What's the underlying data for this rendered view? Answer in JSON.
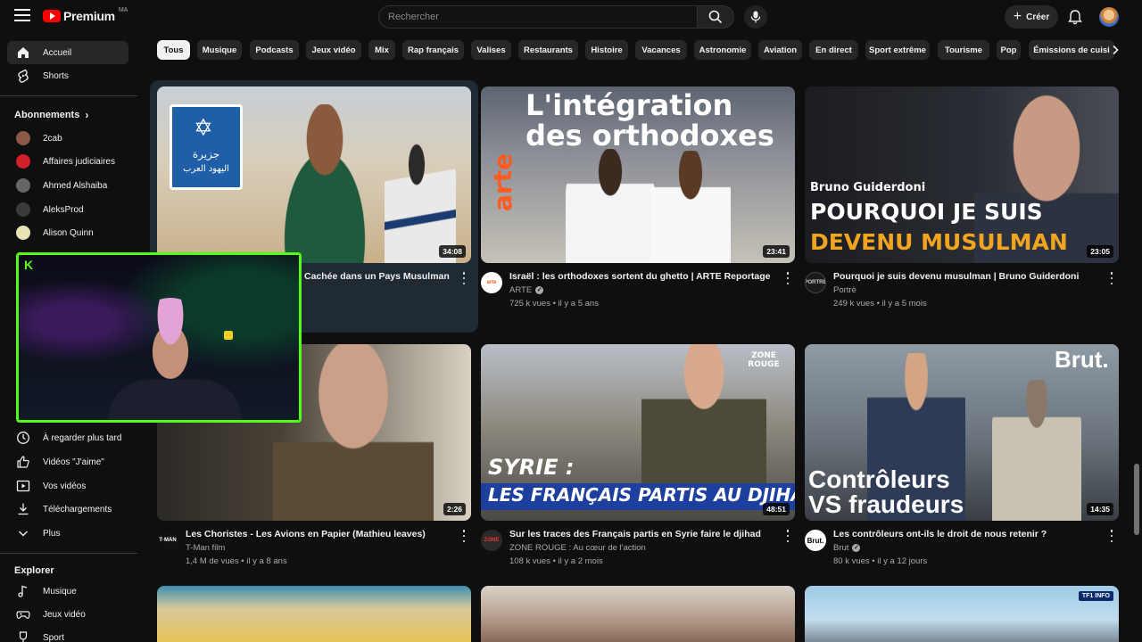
{
  "header": {
    "logo_text": "Premium",
    "logo_region": "MA",
    "search_placeholder": "Rechercher",
    "create_label": "Créer"
  },
  "sidebar": {
    "home": "Accueil",
    "shorts": "Shorts",
    "subscriptions_heading": "Abonnements",
    "subscriptions": [
      {
        "name": "2cab",
        "color": "#8a5a44"
      },
      {
        "name": "Affaires judiciaires",
        "color": "#d0202a"
      },
      {
        "name": "Ahmed Alshaiba",
        "color": "#666666"
      },
      {
        "name": "AleksProd",
        "color": "#3a3a3a"
      },
      {
        "name": "Alison Quinn",
        "color": "#e8e3b5"
      }
    ],
    "you_items": [
      {
        "label": "À regarder plus tard",
        "icon": "clock-icon"
      },
      {
        "label": "Vidéos \"J'aime\"",
        "icon": "thumbs-up-icon"
      },
      {
        "label": "Vos vidéos",
        "icon": "play-square-icon"
      },
      {
        "label": "Téléchargements",
        "icon": "download-icon"
      },
      {
        "label": "Plus",
        "icon": "chevron-down-icon"
      }
    ],
    "explore_heading": "Explorer",
    "explore_items": [
      {
        "label": "Musique",
        "icon": "music-note-icon"
      },
      {
        "label": "Jeux vidéo",
        "icon": "gamepad-icon"
      },
      {
        "label": "Sport",
        "icon": "trophy-icon"
      }
    ]
  },
  "chips": [
    "Tous",
    "Musique",
    "Podcasts",
    "Jeux vidéo",
    "Mix",
    "Rap français",
    "Valises",
    "Restaurants",
    "Histoire",
    "Vacances",
    "Astronomie",
    "Aviation",
    "En direct",
    "Sport extrême",
    "Tourisme",
    "Pop",
    "Émissions de cuisi"
  ],
  "videos": [
    {
      "title": "Cachée dans un Pays Musulman",
      "channel": "",
      "stats": "",
      "duration": "34:08",
      "thumb_text": [
        "جزيرة",
        "اليهود العرب"
      ]
    },
    {
      "title": "Israël : les orthodoxes sortent du ghetto | ARTE Reportage",
      "channel": "ARTE",
      "stats": "725 k vues • il y a 5 ans",
      "duration": "23:41",
      "thumb_text": [
        "L'intégration",
        "des orthodoxes",
        "arte"
      ]
    },
    {
      "title": "Pourquoi je suis devenu musulman | Bruno Guiderdoni",
      "channel": "Portrè",
      "stats": "249 k vues • il y a 5 mois",
      "duration": "23:05",
      "thumb_text": [
        "Bruno Guiderdoni",
        "POURQUOI JE SUIS",
        "DEVENU MUSULMAN"
      ]
    },
    {
      "title": "Les Choristes - Les Avions en Papier (Mathieu leaves)",
      "channel": "T-Man film",
      "stats": "1,4 M de vues • il y a 8 ans",
      "duration": "2:26",
      "thumb_text": []
    },
    {
      "title": "Sur les traces des Français partis en Syrie faire le djihad",
      "channel": "ZONE ROUGE : Au cœur de l'action",
      "stats": "108 k vues • il y a 2 mois",
      "duration": "48:51",
      "thumb_text": [
        "SYRIE :",
        "LES FRANÇAIS PARTIS AU DJIHAD",
        "ZONE ROUGE"
      ]
    },
    {
      "title": "Les contrôleurs ont-ils le droit de nous retenir ?",
      "channel": "Brut",
      "stats": "80 k vues • il y a 12 jours",
      "duration": "14:35",
      "thumb_text": [
        "Brut.",
        "Contrôleurs",
        "VS fraudeurs"
      ]
    }
  ],
  "bottom_badge": "TF1 INFO",
  "colors": {
    "accent_red": "#ff0000",
    "webcam_border": "#53fc18",
    "background": "#0f0f0f"
  }
}
